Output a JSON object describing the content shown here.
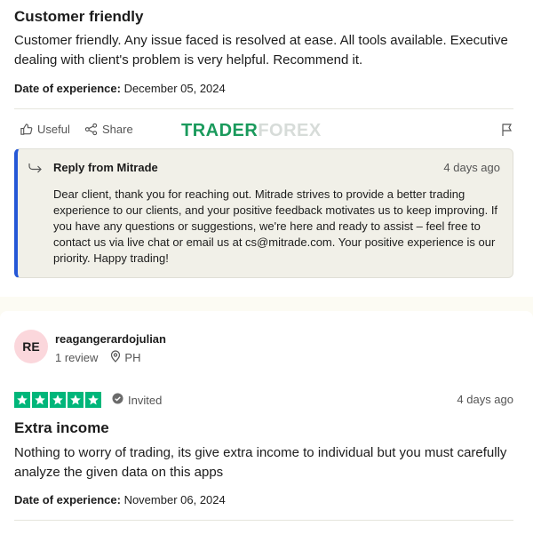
{
  "review1": {
    "title": "Customer friendly",
    "body": "Customer friendly. Any issue faced is resolved at ease. All tools available. Executive dealing with client's problem is very helpful. Recommend it.",
    "date_label": "Date of experience:",
    "date_value": "December 05, 2024",
    "useful_label": "Useful",
    "share_label": "Share",
    "reply": {
      "from": "Reply from Mitrade",
      "date": "4 days ago",
      "text": "Dear client, thank you for reaching out. Mitrade strives to provide a better trading experience to our clients, and your positive feedback motivates us to keep improving. If you have any questions or suggestions, we're here and ready to assist – feel free to contact us via live chat or email us at cs@mitrade.com. Your positive experience is our priority. Happy trading!"
    }
  },
  "watermark": {
    "part1": "TRADER",
    "part2": "FOREX"
  },
  "review2": {
    "avatar_initials": "RE",
    "username": "reagangerardojulian",
    "review_count": "1 review",
    "country": "PH",
    "rating": 5,
    "invited_label": "Invited",
    "date": "4 days ago",
    "title": "Extra income",
    "body": "Nothing to worry of trading, its give extra income to individual but you must carefully analyze the given data on this apps",
    "date_label": "Date of experience:",
    "date_value": "November 06, 2024"
  },
  "colors": {
    "star_green": "#00b67a",
    "reply_accent": "#2557d6",
    "avatar_bg": "#fbd7dc",
    "page_bg": "#fcfbf3"
  },
  "icons": [
    "thumbs-up-icon",
    "share-icon",
    "flag-icon",
    "reply-arrow-icon",
    "location-pin-icon",
    "check-circle-icon",
    "star-icon"
  ]
}
